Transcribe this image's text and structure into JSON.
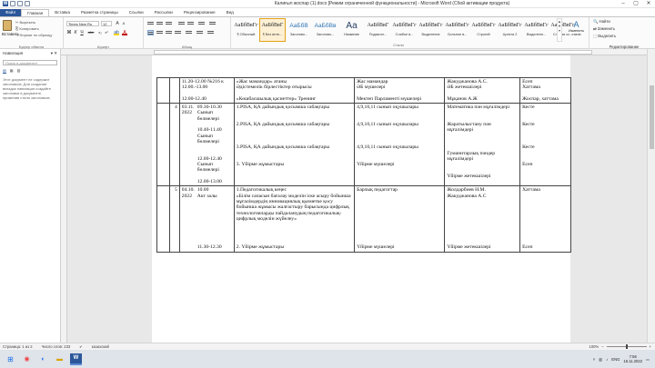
{
  "window": {
    "title": "Калиғыл жоспар (1).docx [Режим ограниченной функциональности] - Microsoft Word (Сбой активации продукта)",
    "controls": [
      "–",
      "▢",
      "✕"
    ]
  },
  "tabs": [
    "Файл",
    "Главная",
    "Вставка",
    "Разметка страницы",
    "Ссылки",
    "Рассылки",
    "Рецензирование",
    "Вид"
  ],
  "ribbon": {
    "clipboard": {
      "paste": "Вставить",
      "cut": "Вырезать",
      "copy": "Копировать",
      "format_painter": "Формат по образцу",
      "group": "Буфер обмена"
    },
    "font": {
      "name": "Times New Ro",
      "size": "12",
      "group": "Шрифт",
      "buttons": [
        "Ж",
        "К",
        "Ч",
        "abe",
        "x₂",
        "x²",
        "A",
        "A"
      ]
    },
    "paragraph": {
      "group": "Абзац"
    },
    "styles": {
      "group": "Стили",
      "items": [
        {
          "preview": "АаБбВвГг",
          "name": "¶ Обычный"
        },
        {
          "preview": "АаБбВвГ",
          "name": "¶ Без инте..."
        },
        {
          "preview": "АаБбВ",
          "name": "Заголово..."
        },
        {
          "preview": "АаБбВв",
          "name": "Заголово..."
        },
        {
          "preview": "Аа",
          "name": "Название"
        },
        {
          "preview": "АаБбВвГ",
          "name": "Подзагол..."
        },
        {
          "preview": "АаБбВвГг",
          "name": "Слабое в..."
        },
        {
          "preview": "АаБбВвГг",
          "name": "Выделение"
        },
        {
          "preview": "АаБбВвГг",
          "name": "Сильное в..."
        },
        {
          "preview": "АаБбВвГг",
          "name": "Строгий"
        },
        {
          "preview": "АаБбВвГг",
          "name": "Цитата 2"
        },
        {
          "preview": "АаБбВвГг",
          "name": "Выделенн..."
        },
        {
          "preview": "АаБбВвГг",
          "name": "Слабая сс..."
        }
      ],
      "change": "Изменить стили"
    },
    "editing": {
      "find": "Найти",
      "replace": "Заменить",
      "select": "Выделить",
      "group": "Редактирование"
    }
  },
  "nav": {
    "title": "Навигация",
    "search_placeholder": "Поиск в документе",
    "tabs": [
      "▤",
      "▦",
      "▧"
    ],
    "message": "Этот документ не содержит заголовков. Для создания вкладок навигации создайте заголовки в документе, применив стили заголовков."
  },
  "table": {
    "rows": [
      {
        "num": "",
        "date": "",
        "time": [
          "11.20-12.00 №216 к",
          "12.00.-13.00",
          "",
          "12.00-12.40"
        ],
        "event": [
          "«Жас мамандар» атаны",
          "Әдістемелік бірлестіктер отырысы",
          "",
          "«Көшбасшылық қасиеттер» Тренинг"
        ],
        "audience": [
          "Жас мамандар",
          "ӘБ мүшелері",
          "",
          "Мектеп Парламенті мүшелері"
        ],
        "resp": [
          "Жакуджанова А.С.",
          "ӘБ жетекшілері",
          "",
          "Мұқанов А.Ж"
        ],
        "result": [
          "Есеп",
          "Хаттама",
          "",
          "Жоспар, хаттама"
        ]
      },
      {
        "num": "4",
        "date": "03.11. 2022",
        "time": [
          "09.30-10.30",
          "Сынып бөлмелері",
          "",
          "10.40-11.40",
          "Сынып бөлмелері",
          "",
          "",
          "12.00-12.40",
          "Сынып бөлмелері",
          "",
          "12.00-13.00"
        ],
        "event": [
          "1.PISA, ҚА дайындық қосымша сабақтары",
          "",
          "",
          "2.PISA, ҚА дайындық қосымша сабақтары",
          "",
          "",
          "",
          "3.PISA, ҚА дайындық қосымша сабақтары",
          "",
          "",
          "3. Үйірме жұмыстары"
        ],
        "audience": [
          "4,9,10,11 сынып оқушылары",
          "",
          "",
          "4,9,10,11 сынып оқушылары",
          "",
          "",
          "",
          "4,9,10,11 сынып оқушылары",
          "",
          "",
          "Үйірме мүшелері"
        ],
        "resp": [
          "Математика пән мұғалімдері",
          "",
          "",
          "Жаратылыстану пән мұғалімдері",
          "",
          "",
          "",
          "Гуманитарлық пәндер мұғалімдері",
          "",
          "",
          "Үйірме жетекшілері"
        ],
        "result": [
          "Кесте",
          "",
          "",
          "Кесте",
          "",
          "",
          "",
          "Кесте",
          "",
          "",
          "Есеп"
        ]
      },
      {
        "num": "5",
        "date": "04.10. 2022",
        "time": [
          "10.00",
          "Акт залы",
          "",
          "",
          "",
          "",
          "",
          "",
          "",
          "",
          "11.30-12.30"
        ],
        "event": [
          "1.Педагогикалық кеңес",
          "«Білім сапасын бағалау моделін іске асыру бойынша мұғалімдердің инновациялық қызметке қосу бойынша жұмысы жалғастыру барысында цифрлық технологияларды пайдаланудың педагогикалық-цифрлық моделін жүйелеу»",
          "",
          "",
          "",
          "",
          "2. Үйірме жұмыстары"
        ],
        "audience": [
          "Барлық педагогтар",
          "",
          "",
          "",
          "",
          "",
          "",
          "",
          "",
          "",
          "Үйірме мүшелері"
        ],
        "resp": [
          "Жолдарбиев Н.М.",
          "Жакуджанова А.С",
          "",
          "",
          "",
          "",
          "",
          "",
          "",
          "",
          "Үйірме жетекшілері"
        ],
        "result": [
          "Хаттама",
          "",
          "",
          "",
          "",
          "",
          "",
          "",
          "",
          "",
          "Есеп"
        ]
      }
    ]
  },
  "status": {
    "page": "Страница: 1 из 2",
    "words": "Число слов: 233",
    "language": "казахский",
    "zoom": "100%"
  },
  "taskbar": {
    "lang": "ENG",
    "time": "7:56",
    "date": "16.11.2022"
  }
}
